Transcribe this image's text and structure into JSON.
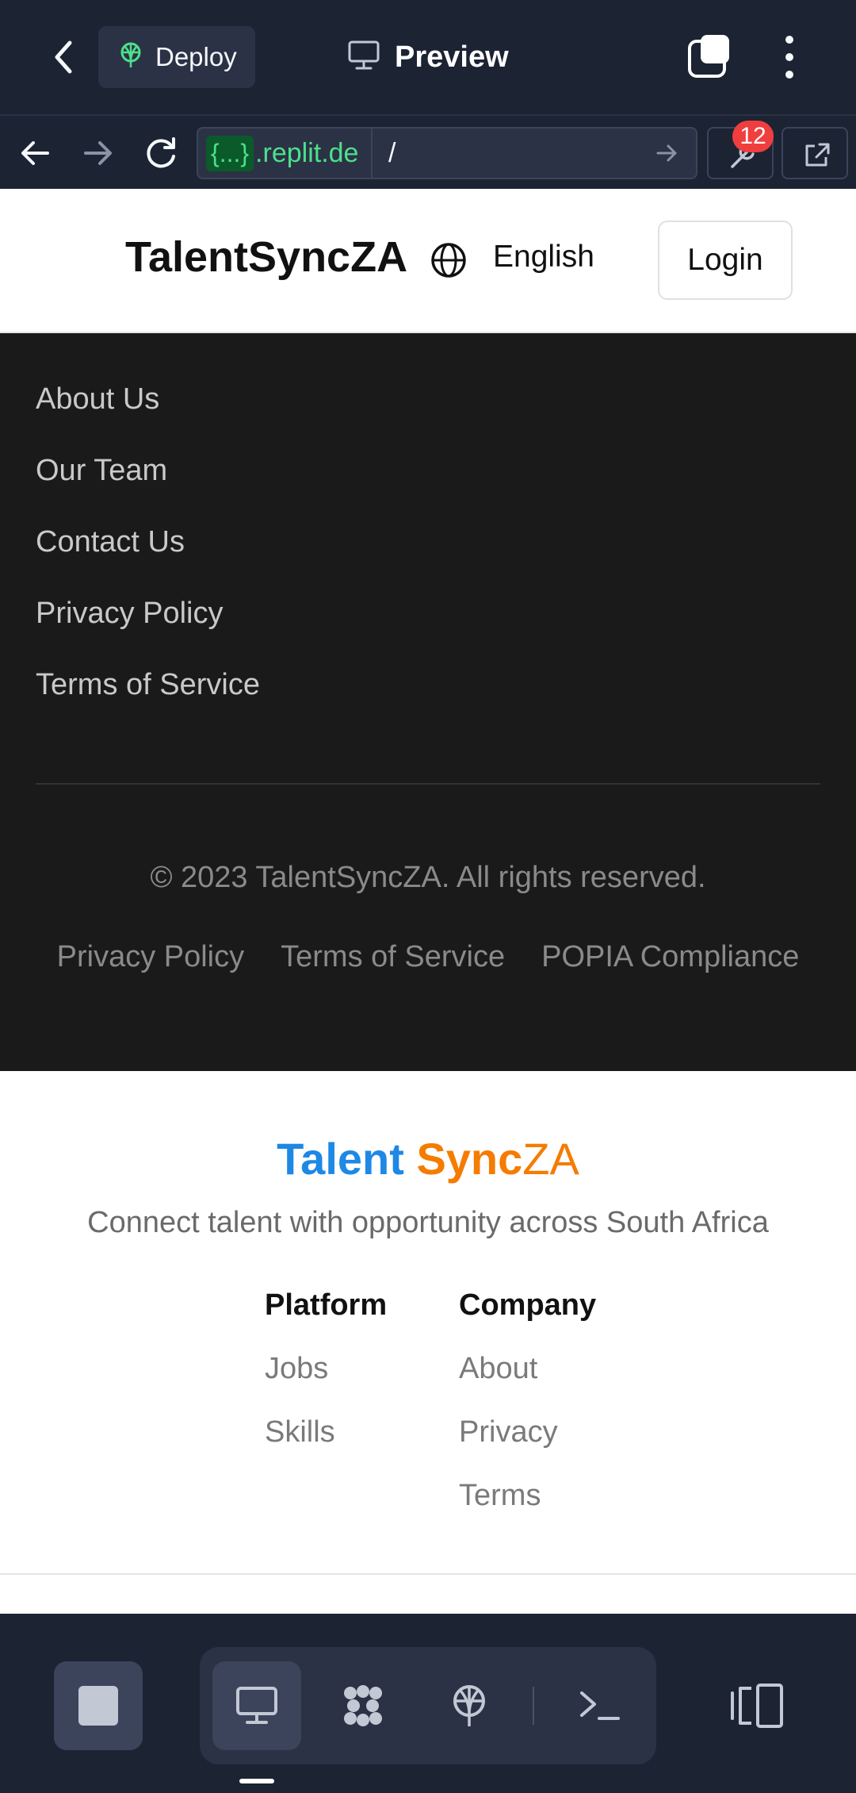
{
  "topbar": {
    "deploy_label": "Deploy",
    "preview_label": "Preview"
  },
  "urlbar": {
    "host_badge": "{...}",
    "host_domain": ".replit.de",
    "path": "/",
    "notification_count": "12"
  },
  "site_header": {
    "brand": "TalentSyncZA",
    "language": "English",
    "login_label": "Login"
  },
  "dark_footer": {
    "links": [
      "About Us",
      "Our Team",
      "Contact Us",
      "Privacy Policy",
      "Terms of Service"
    ],
    "copyright": "© 2023 TalentSyncZA. All rights reserved.",
    "legal_links": [
      "Privacy Policy",
      "Terms of Service",
      "POPIA Compliance"
    ]
  },
  "light_footer": {
    "logo_part1": "Talent ",
    "logo_part2": "Sync",
    "logo_part3": "ZA",
    "tagline": "Connect talent with opportunity across South Africa",
    "platform": {
      "heading": "Platform",
      "links": [
        "Jobs",
        "Skills"
      ]
    },
    "company": {
      "heading": "Company",
      "links": [
        "About",
        "Privacy",
        "Terms"
      ]
    }
  },
  "colors": {
    "chrome_bg": "#1c2333",
    "dark_footer_bg": "#1a1a1a",
    "logo_blue": "#1e88e5",
    "logo_orange": "#f57c00",
    "badge_red": "#f03e3e",
    "url_green": "#4ce08a"
  },
  "icons": [
    "chevron-left-icon",
    "deploy-icon",
    "monitor-icon",
    "tabs-icon",
    "more-vertical-icon",
    "arrow-left-icon",
    "arrow-right-icon",
    "refresh-icon",
    "arrow-go-icon",
    "devtools-icon",
    "external-link-icon",
    "globe-icon",
    "stop-icon",
    "preview-icon",
    "apps-icon",
    "deployments-icon",
    "shell-icon",
    "layout-icon"
  ]
}
